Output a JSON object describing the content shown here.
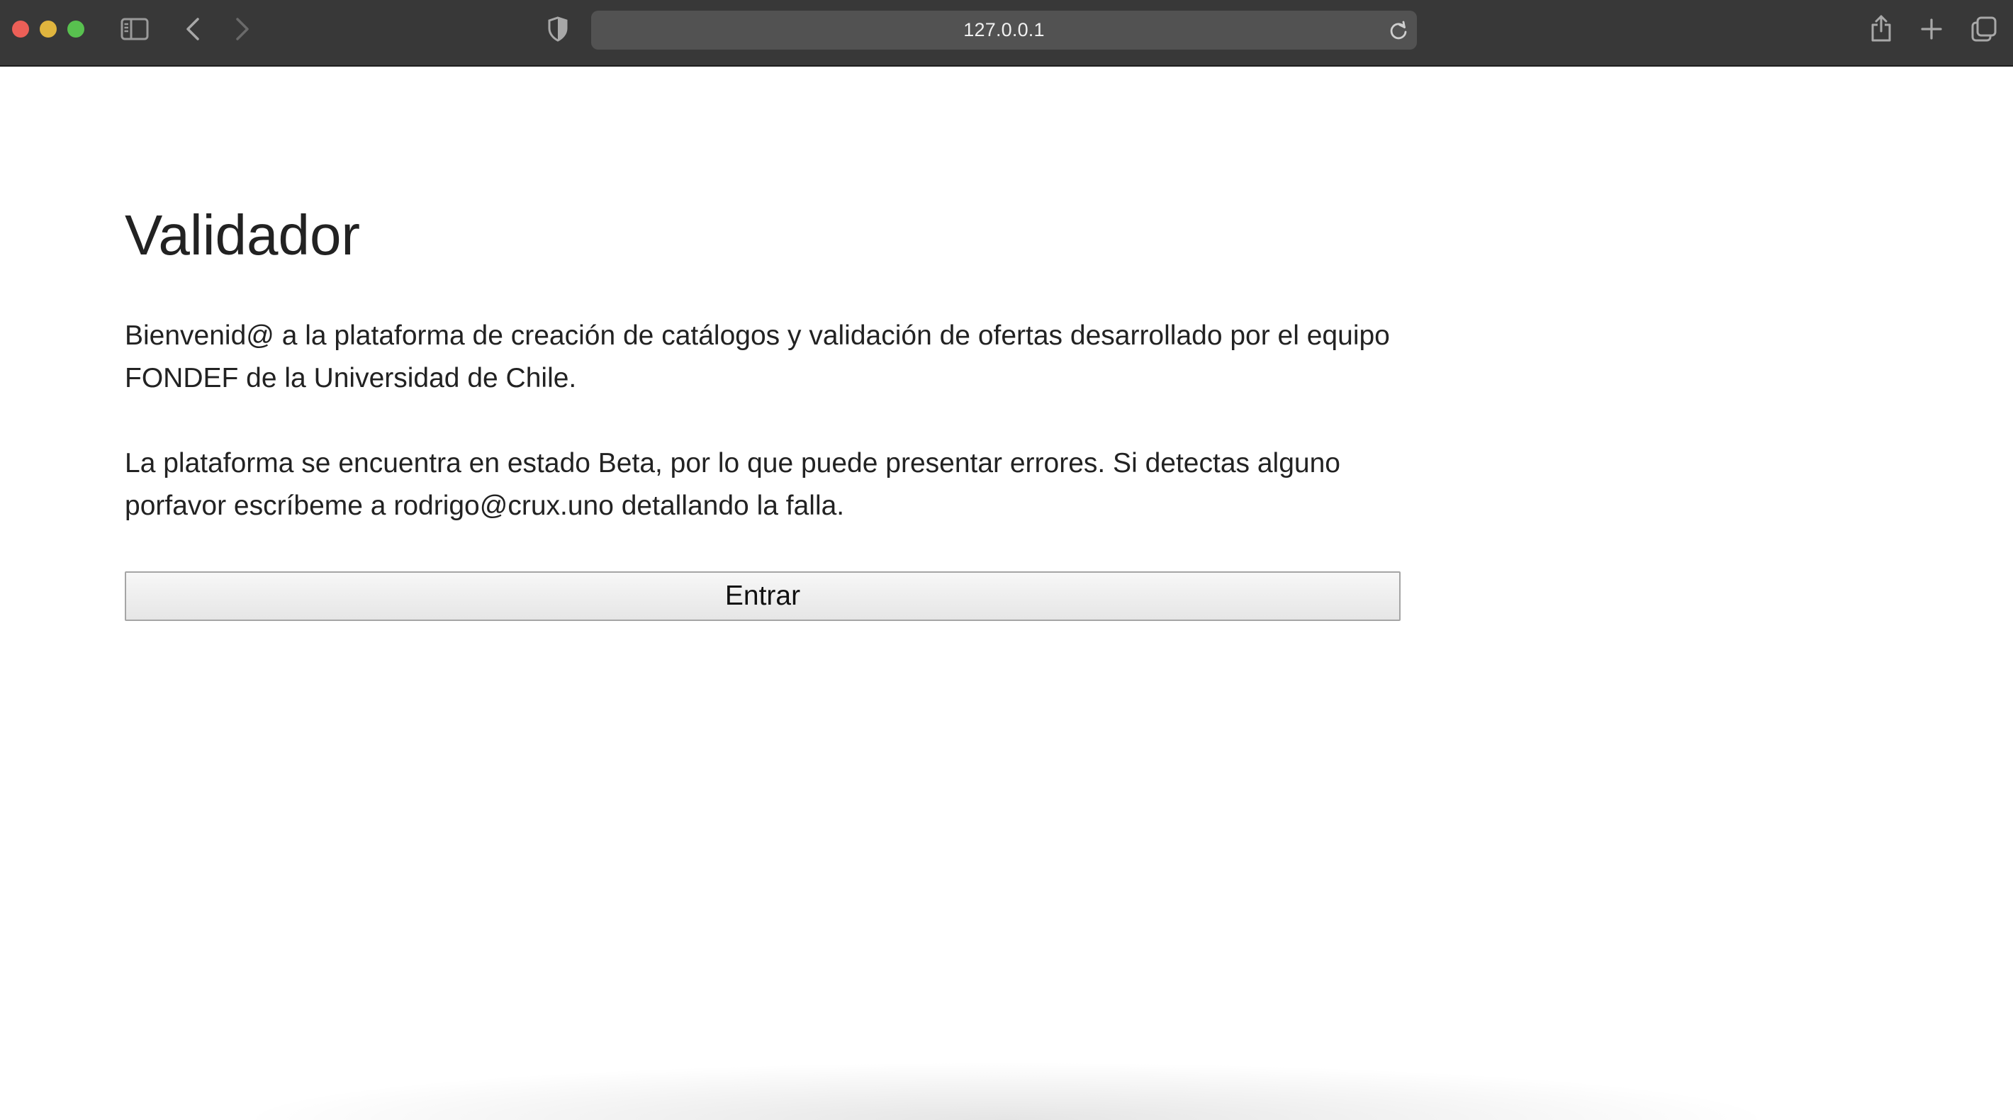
{
  "browser": {
    "url": "127.0.0.1",
    "icons": {
      "close": "close-window-dot",
      "minimize": "minimize-window-dot",
      "maximize": "zoom-window-dot",
      "sidebar": "sidebar-icon",
      "back": "chevron-left-icon",
      "forward": "chevron-right-icon",
      "privacy": "shield-icon",
      "reload": "reload-icon",
      "share": "share-icon",
      "new_tab": "plus-icon",
      "tab_overview": "tabs-overview-icon"
    },
    "colors": {
      "toolbar": "#383838",
      "url_field": "#525252",
      "close": "#ec5f57",
      "minimize": "#e0b53e",
      "maximize": "#58c14f"
    }
  },
  "page": {
    "title": "Validador",
    "paragraph_1": "Bienvenid@ a la plataforma de creación de catálogos y validación de ofertas desarrollado por el equipo FONDEF de la Universidad de Chile.",
    "paragraph_2": "La plataforma se encuentra en estado Beta, por lo que puede presentar errores. Si detectas alguno porfavor escríbeme a rodrigo@crux.uno detallando la falla.",
    "enter_button_label": "Entrar"
  }
}
